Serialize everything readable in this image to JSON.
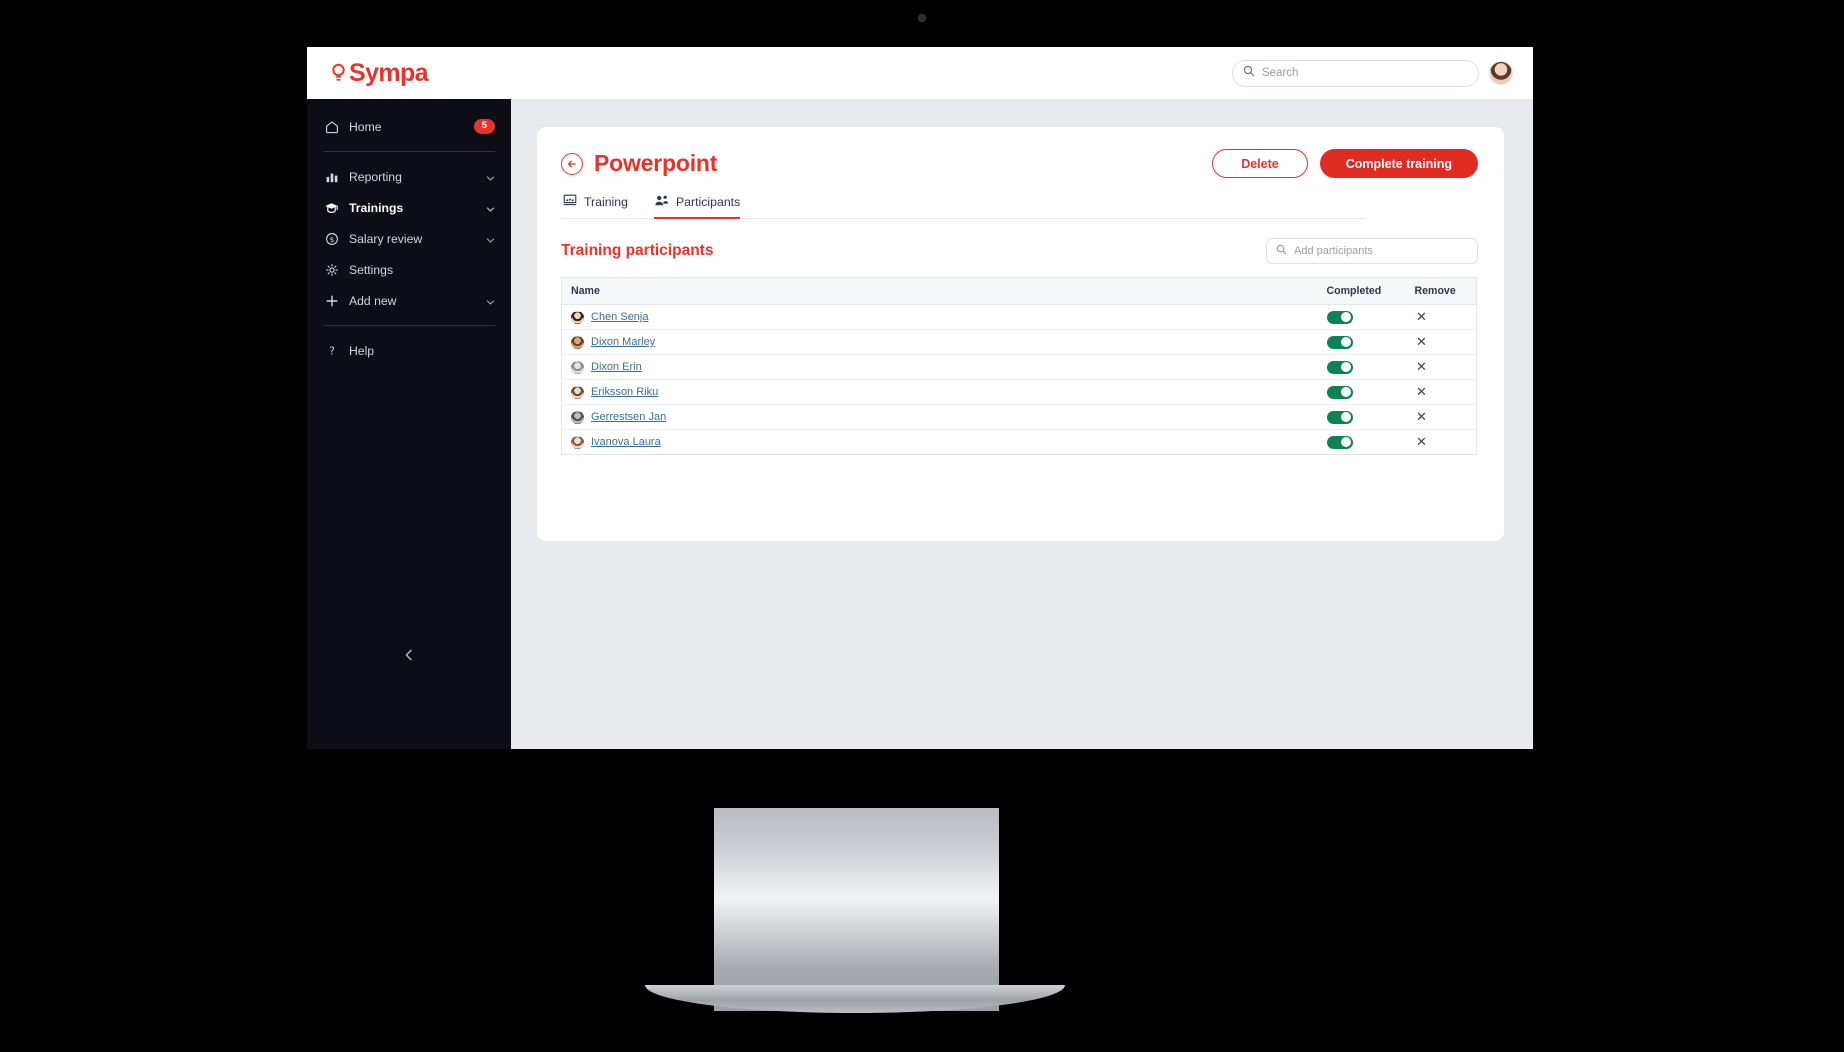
{
  "brand": {
    "name": "Sympa",
    "logo_icon": "lightbulb-icon",
    "color": "#e8332a"
  },
  "topbar": {
    "search": {
      "placeholder": "Search",
      "value": "",
      "icon": "search-icon"
    },
    "avatar": {
      "icon": "user-avatar"
    }
  },
  "sidebar": {
    "items": [
      {
        "label": "Home",
        "icon": "home-icon",
        "badge": "5",
        "chevron": false,
        "active": false
      },
      {
        "label": "Reporting",
        "icon": "bar-chart-icon",
        "badge": "",
        "chevron": true,
        "active": false
      },
      {
        "label": "Trainings",
        "icon": "graduation-cap-icon",
        "badge": "",
        "chevron": true,
        "active": true
      },
      {
        "label": "Salary review",
        "icon": "dollar-circle-icon",
        "badge": "",
        "chevron": true,
        "active": false
      },
      {
        "label": "Settings",
        "icon": "gear-icon",
        "badge": "",
        "chevron": false,
        "active": false
      },
      {
        "label": "Add new",
        "icon": "plus-icon",
        "badge": "",
        "chevron": true,
        "active": false
      },
      {
        "label": "Help",
        "icon": "question-mark-icon",
        "badge": "",
        "chevron": false,
        "active": false
      }
    ],
    "collapse_icon": "chevron-left-icon"
  },
  "page": {
    "title": "Powerpoint",
    "back_icon": "arrow-left-circle-icon",
    "actions": {
      "delete_label": "Delete",
      "complete_label": "Complete training"
    },
    "tabs": [
      {
        "label": "Training",
        "icon": "presentation-icon",
        "active": false
      },
      {
        "label": "Participants",
        "icon": "people-group-icon",
        "active": true
      }
    ],
    "section": {
      "title": "Training participants",
      "add_participants": {
        "placeholder": "Add participants",
        "value": "",
        "icon": "search-icon"
      }
    },
    "table": {
      "columns": [
        "Name",
        "Completed",
        "Remove"
      ],
      "rows": [
        {
          "name": "Chen Senja",
          "completed": true,
          "remove_icon": "close-icon",
          "avatar_colors": [
            "#f2d5bd",
            "#3a2418"
          ]
        },
        {
          "name": "Dixon Marley",
          "completed": true,
          "remove_icon": "close-icon",
          "avatar_colors": [
            "#d9a87f",
            "#6a4327"
          ]
        },
        {
          "name": "Dixon Erin",
          "completed": true,
          "remove_icon": "close-icon",
          "avatar_colors": [
            "#e8e2dd",
            "#9a8d84"
          ]
        },
        {
          "name": "Eriksson Riku",
          "completed": true,
          "remove_icon": "close-icon",
          "avatar_colors": [
            "#e9dccf",
            "#6d4b33"
          ]
        },
        {
          "name": "Gerrestsen Jan",
          "completed": true,
          "remove_icon": "close-icon",
          "avatar_colors": [
            "#b9bdc2",
            "#4d5257"
          ]
        },
        {
          "name": "Ivanova Laura",
          "completed": true,
          "remove_icon": "close-icon",
          "avatar_colors": [
            "#f0ddd0",
            "#8c5a3c"
          ]
        }
      ]
    }
  }
}
